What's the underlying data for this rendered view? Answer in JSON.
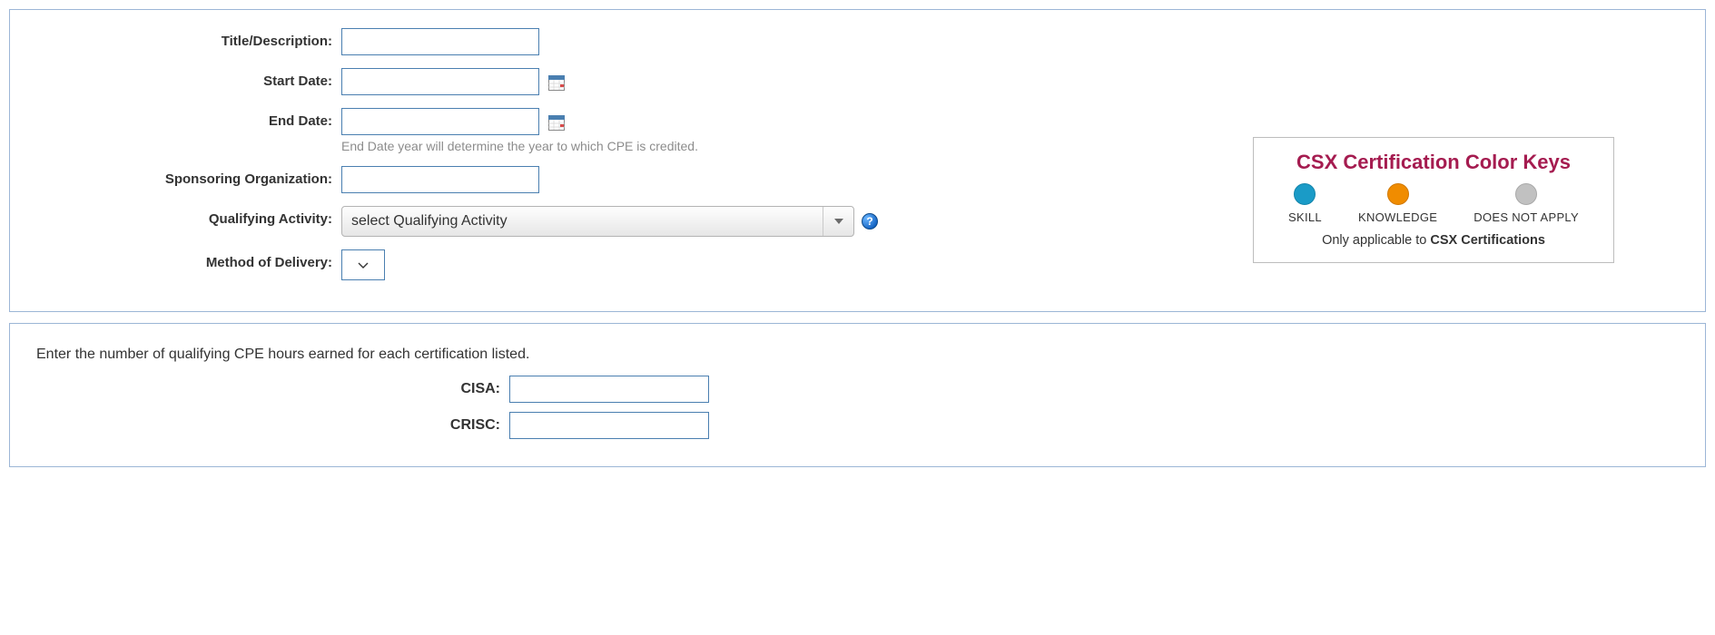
{
  "form": {
    "title_label": "Title/Description:",
    "title_value": "",
    "start_label": "Start Date:",
    "start_value": "",
    "end_label": "End Date:",
    "end_value": "",
    "end_hint": "End Date year will determine the year to which CPE is credited.",
    "sponsor_label": "Sponsoring Organization:",
    "sponsor_value": "",
    "activity_label": "Qualifying Activity:",
    "activity_selected": "select Qualifying Activity",
    "delivery_label": "Method of Delivery:",
    "delivery_selected": ""
  },
  "colorkeys": {
    "title": "CSX Certification Color Keys",
    "skill_label": "SKILL",
    "knowledge_label": "KNOWLEDGE",
    "na_label": "DOES NOT APPLY",
    "footer_prefix": "Only applicable to ",
    "footer_bold": "CSX Certifications"
  },
  "hours": {
    "instruction": "Enter the number of qualifying CPE hours earned for each certification listed.",
    "certs": [
      {
        "label": "CISA:",
        "value": ""
      },
      {
        "label": "CRISC:",
        "value": ""
      }
    ]
  }
}
